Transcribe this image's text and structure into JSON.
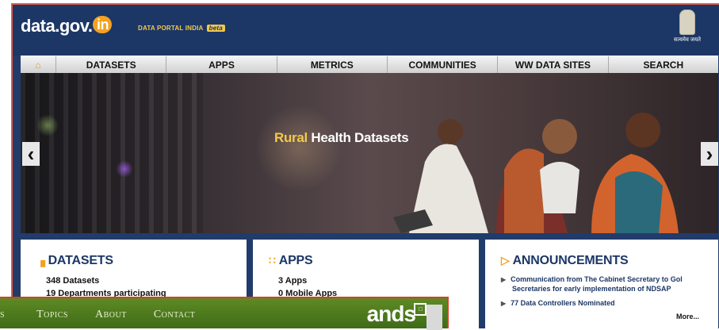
{
  "header": {
    "logo_text": "data.gov.",
    "logo_badge": "in",
    "portal_label": "DATA PORTAL INDIA",
    "beta_label": "beta",
    "emblem_motto": "सत्यमेव जयते"
  },
  "nav": {
    "home_icon": "home-icon",
    "items": [
      "DATASETS",
      "APPS",
      "METRICS",
      "COMMUNITIES",
      "WW DATA SITES",
      "SEARCH"
    ]
  },
  "banner": {
    "title_highlight": "Rural",
    "title_rest": " Health Datasets",
    "prev_icon": "chevron-left-icon",
    "next_icon": "chevron-right-icon"
  },
  "panels": {
    "datasets": {
      "heading": "DATASETS",
      "count_value": "348",
      "count_label": " Datasets",
      "departments_value": "19",
      "departments_label": " Departments participating"
    },
    "apps": {
      "heading": "APPS",
      "apps_value": "3",
      "apps_label": " Apps",
      "mobile_value": "0",
      "mobile_label": " Mobile Apps"
    },
    "announcements": {
      "heading": "ANNOUNCEMENTS",
      "items": [
        "Communication from The Cabinet Secretary to Gol",
        "Secretaries for early implementation of NDSAP",
        "77 Data Controllers Nominated"
      ],
      "more_label": "More..."
    }
  },
  "overlay": {
    "items": [
      "s",
      "Topics",
      "About",
      "Contact"
    ],
    "logo_text": "ands"
  },
  "colors": {
    "header_bg": "#1c3766",
    "accent": "#f4a21f",
    "highlight": "#f2c94c",
    "overlay_green": "#4f7a1f",
    "border_red": "#e05a4a"
  }
}
